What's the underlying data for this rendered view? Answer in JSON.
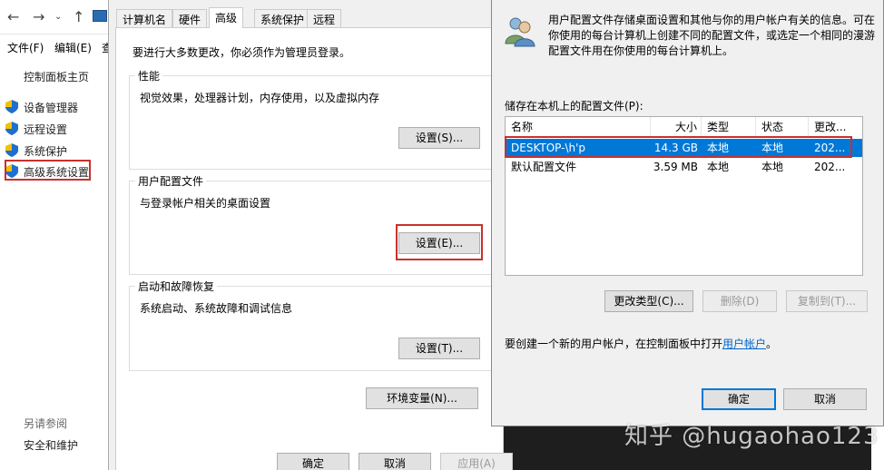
{
  "explorer": {
    "menu": [
      "文件(F)",
      "编辑(E)",
      "查"
    ],
    "cp_home": "控制面板主页",
    "links": [
      "设备管理器",
      "远程设置",
      "系统保护",
      "高级系统设置"
    ],
    "see_also": "另请参阅",
    "security": "安全和维护"
  },
  "sysprops": {
    "tabs": [
      "计算机名",
      "硬件",
      "高级",
      "系统保护",
      "远程"
    ],
    "admin_note": "要进行大多数更改，你必须作为管理员登录。",
    "performance": {
      "title": "性能",
      "desc": "视觉效果，处理器计划，内存使用，以及虚拟内存",
      "button": "设置(S)..."
    },
    "user_profiles": {
      "title": "用户配置文件",
      "desc": "与登录帐户相关的桌面设置",
      "button": "设置(E)..."
    },
    "startup": {
      "title": "启动和故障恢复",
      "desc": "系统启动、系统故障和调试信息",
      "button": "设置(T)..."
    },
    "env_button": "环境变量(N)...",
    "ok": "确定",
    "cancel": "取消",
    "apply": "应用(A)"
  },
  "profiles_dialog": {
    "intro": "用户配置文件存储桌面设置和其他与你的用户帐户有关的信息。可在你使用的每台计算机上创建不同的配置文件，或选定一个相同的漫游配置文件用在你使用的每台计算机上。",
    "list_label": "储存在本机上的配置文件(P):",
    "columns": [
      "名称",
      "大小",
      "类型",
      "状态",
      "更改..."
    ],
    "rows": [
      {
        "name": "DESKTOP-\\h'p",
        "size": "14.3 GB",
        "type": "本地",
        "status": "本地",
        "modified": "202..."
      },
      {
        "name": "默认配置文件",
        "size": "3.59 MB",
        "type": "本地",
        "status": "本地",
        "modified": "202..."
      }
    ],
    "change_type": "更改类型(C)...",
    "delete": "删除(D)",
    "copy_to": "复制到(T)...",
    "create_note": "要创建一个新的用户帐户，在控制面板中打开",
    "create_link": "用户帐户",
    "create_end": "。",
    "ok": "确定",
    "cancel": "取消"
  },
  "watermark": "知乎 @hugaohao123",
  "colors": {
    "selection": "#0078d7",
    "highlight_box": "#c9302c",
    "link": "#0066cc"
  }
}
